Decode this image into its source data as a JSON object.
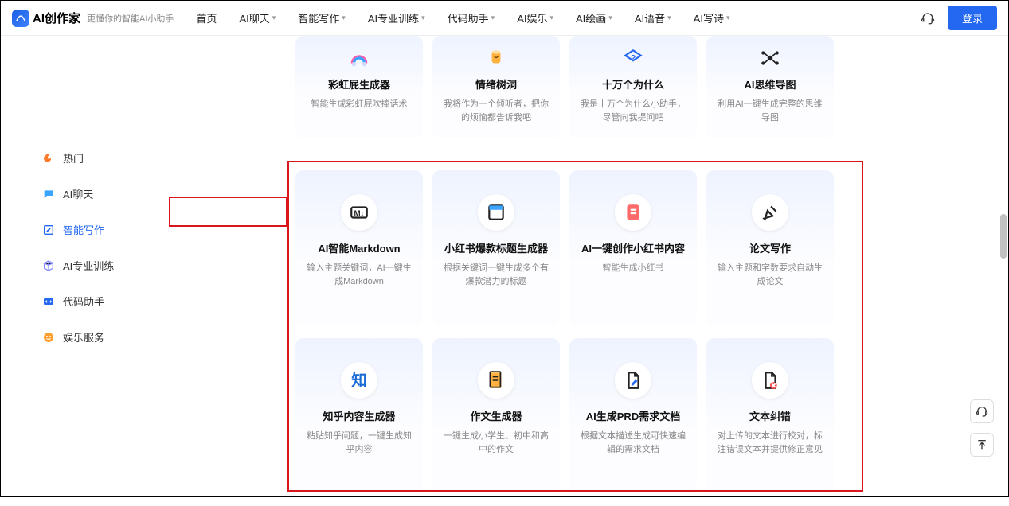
{
  "header": {
    "brand": "AI创作家",
    "tagline": "更懂你的智能AI小助手",
    "nav": [
      "首页",
      "AI聊天",
      "智能写作",
      "AI专业训练",
      "代码助手",
      "AI娱乐",
      "AI绘画",
      "AI语音",
      "AI写诗"
    ],
    "nav_has_dropdown": [
      false,
      true,
      true,
      true,
      true,
      true,
      true,
      true,
      true
    ],
    "login": "登录"
  },
  "sidebar": {
    "items": [
      {
        "label": "热门",
        "icon": "flame"
      },
      {
        "label": "AI聊天",
        "icon": "chat"
      },
      {
        "label": "智能写作",
        "icon": "edit",
        "active": true
      },
      {
        "label": "AI专业训练",
        "icon": "cube"
      },
      {
        "label": "代码助手",
        "icon": "code"
      },
      {
        "label": "娱乐服务",
        "icon": "smile"
      }
    ]
  },
  "cards_top": [
    {
      "title": "彩虹屁生成器",
      "desc": "智能生成彩虹屁吹捧话术",
      "icon": "rainbow"
    },
    {
      "title": "情绪树洞",
      "desc": "我将作为一个倾听者，把你的烦恼都告诉我吧",
      "icon": "cup"
    },
    {
      "title": "十万个为什么",
      "desc": "我是十万个为什么小助手，尽管向我提问吧",
      "icon": "question"
    },
    {
      "title": "AI思维导图",
      "desc": "利用AI一键生成完整的思维导图",
      "icon": "mindmap"
    }
  ],
  "cards_mid": [
    {
      "title": "AI智能Markdown",
      "desc": "输入主题关键词，AI一键生成Markdown",
      "icon": "md"
    },
    {
      "title": "小红书爆款标题生成器",
      "desc": "根据关键词一键生成多个有爆款潜力的标题",
      "icon": "window"
    },
    {
      "title": "AI一键创作小红书内容",
      "desc": "智能生成小红书",
      "icon": "doc"
    },
    {
      "title": "论文写作",
      "desc": "输入主题和字数要求自动生成论文",
      "icon": "pen"
    }
  ],
  "cards_bot": [
    {
      "title": "知乎内容生成器",
      "desc": "粘贴知乎问题，一键生成知乎内容",
      "icon": "zhi"
    },
    {
      "title": "作文生成器",
      "desc": "一键生成小学生、初中和高中的作文",
      "icon": "paper"
    },
    {
      "title": "AI生成PRD需求文档",
      "desc": "根据文本描述生成可快速编辑的需求文档",
      "icon": "fileedit"
    },
    {
      "title": "文本纠错",
      "desc": "对上传的文本进行校对，标注错误文本并提供修正意见",
      "icon": "fileerr"
    }
  ]
}
